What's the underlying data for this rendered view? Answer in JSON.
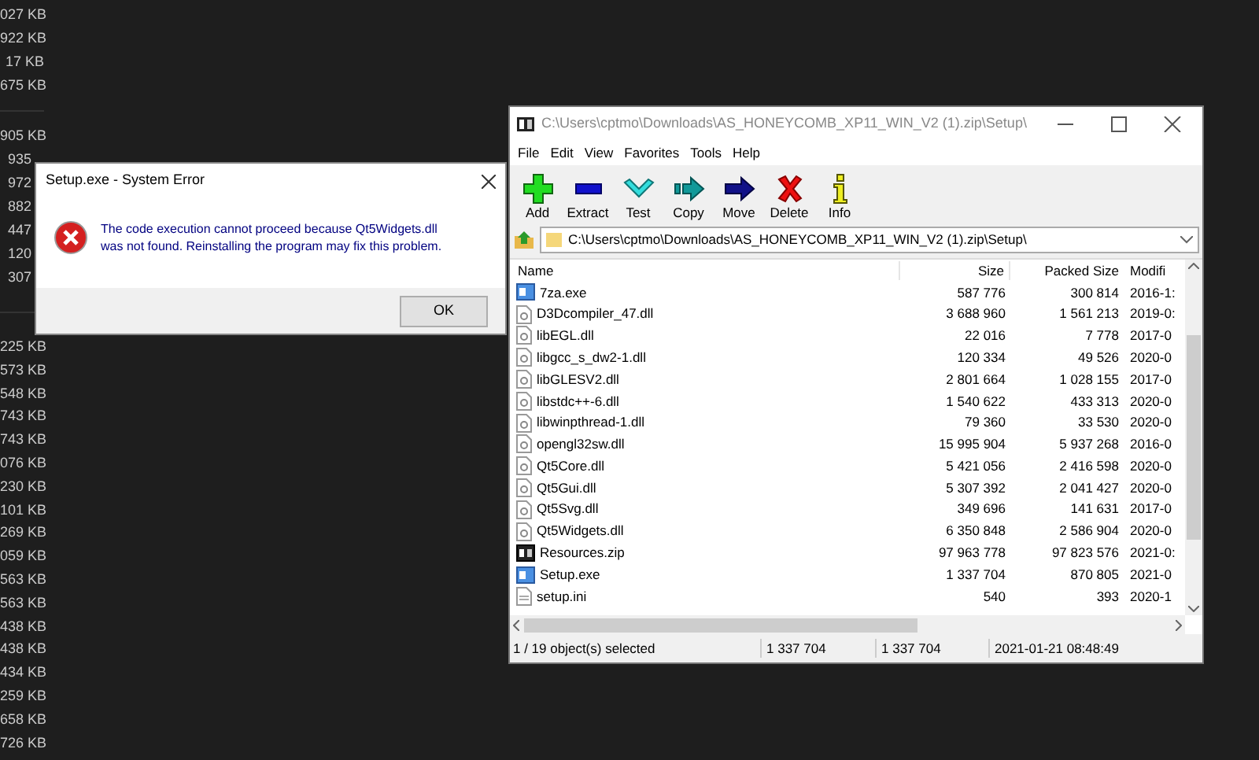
{
  "background_sizes": [
    [
      "027 KB",
      "922 KB",
      "17 KB",
      "675 KB"
    ],
    [
      "905 KB",
      "935",
      "972",
      "882",
      "447",
      "120",
      "307"
    ],
    [
      "225 KB",
      "573 KB",
      "548 KB",
      "743 KB",
      "743 KB",
      "076 KB",
      "230 KB",
      "101 KB",
      "269 KB",
      "059 KB",
      "563 KB",
      "563 KB",
      "438 KB",
      "438 KB",
      "434 KB",
      "259 KB",
      "658 KB",
      "726 KB"
    ]
  ],
  "error_dialog": {
    "title": "Setup.exe - System Error",
    "message": "The code execution cannot proceed because Qt5Widgets.dll was not found. Reinstalling the program may fix this problem.",
    "button": "OK"
  },
  "archive_window": {
    "title": "C:\\Users\\cptmo\\Downloads\\AS_HONEYCOMB_XP11_WIN_V2 (1).zip\\Setup\\",
    "menu": [
      "File",
      "Edit",
      "View",
      "Favorites",
      "Tools",
      "Help"
    ],
    "toolbar": [
      {
        "kind": "add",
        "label": "Add"
      },
      {
        "kind": "extract",
        "label": "Extract"
      },
      {
        "kind": "test",
        "label": "Test"
      },
      {
        "kind": "copy",
        "label": "Copy"
      },
      {
        "kind": "move",
        "label": "Move"
      },
      {
        "kind": "delete",
        "label": "Delete"
      },
      {
        "kind": "info",
        "label": "Info"
      }
    ],
    "address": "C:\\Users\\cptmo\\Downloads\\AS_HONEYCOMB_XP11_WIN_V2 (1).zip\\Setup\\",
    "columns": [
      "Name",
      "Size",
      "Packed Size",
      "Modifi"
    ],
    "rows": [
      {
        "kind": "exe",
        "name": "7za.exe",
        "size": "587 776",
        "packed": "300 814",
        "modified": "2016-1:"
      },
      {
        "kind": "dll",
        "name": "D3Dcompiler_47.dll",
        "size": "3 688 960",
        "packed": "1 561 213",
        "modified": "2019-0:"
      },
      {
        "kind": "dll",
        "name": "libEGL.dll",
        "size": "22 016",
        "packed": "7 778",
        "modified": "2017-0"
      },
      {
        "kind": "dll",
        "name": "libgcc_s_dw2-1.dll",
        "size": "120 334",
        "packed": "49 526",
        "modified": "2020-0"
      },
      {
        "kind": "dll",
        "name": "libGLESV2.dll",
        "size": "2 801 664",
        "packed": "1 028 155",
        "modified": "2017-0"
      },
      {
        "kind": "dll",
        "name": "libstdc++-6.dll",
        "size": "1 540 622",
        "packed": "433 313",
        "modified": "2020-0"
      },
      {
        "kind": "dll",
        "name": "libwinpthread-1.dll",
        "size": "79 360",
        "packed": "33 530",
        "modified": "2020-0"
      },
      {
        "kind": "dll",
        "name": "opengl32sw.dll",
        "size": "15 995 904",
        "packed": "5 937 268",
        "modified": "2016-0"
      },
      {
        "kind": "dll",
        "name": "Qt5Core.dll",
        "size": "5 421 056",
        "packed": "2 416 598",
        "modified": "2020-0"
      },
      {
        "kind": "dll",
        "name": "Qt5Gui.dll",
        "size": "5 307 392",
        "packed": "2 041 427",
        "modified": "2020-0"
      },
      {
        "kind": "dll",
        "name": "Qt5Svg.dll",
        "size": "349 696",
        "packed": "141 631",
        "modified": "2017-0"
      },
      {
        "kind": "dll",
        "name": "Qt5Widgets.dll",
        "size": "6 350 848",
        "packed": "2 586 904",
        "modified": "2020-0"
      },
      {
        "kind": "zip",
        "name": "Resources.zip",
        "size": "97 963 778",
        "packed": "97 823 576",
        "modified": "2021-0:"
      },
      {
        "kind": "exe",
        "name": "Setup.exe",
        "size": "1 337 704",
        "packed": "870 805",
        "modified": "2021-0"
      },
      {
        "kind": "ini",
        "name": "setup.ini",
        "size": "540",
        "packed": "393",
        "modified": "2020-1"
      }
    ],
    "status": [
      "1 / 19 object(s) selected",
      "1 337 704",
      "1 337 704",
      "2021-01-21 08:48:49"
    ]
  }
}
